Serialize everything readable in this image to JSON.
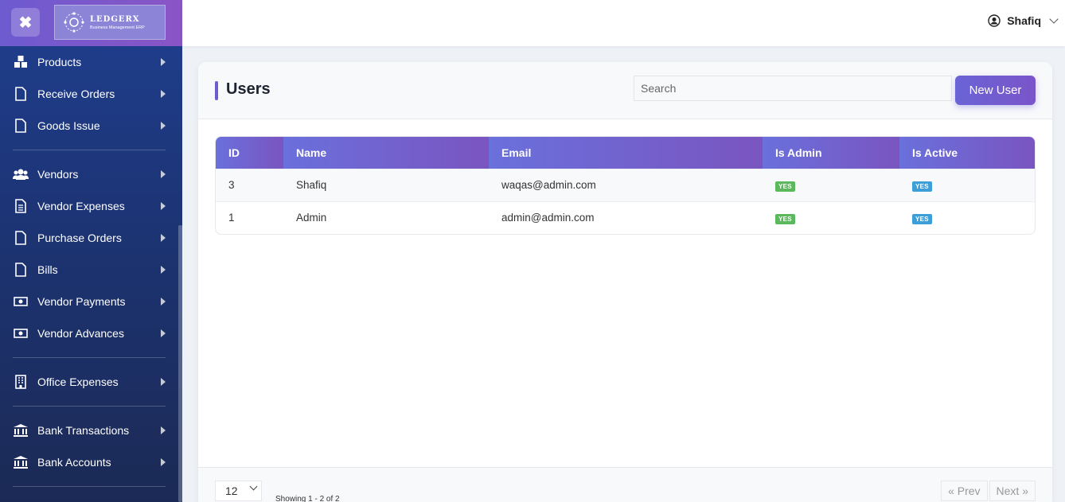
{
  "sidebar": {
    "logo": {
      "title": "LEDGERX",
      "subtitle": "Business Management ERP"
    },
    "items": [
      {
        "label": "Products",
        "icon": "boxes-icon"
      },
      {
        "label": "Receive Orders",
        "icon": "file-icon"
      },
      {
        "label": "Goods Issue",
        "icon": "file-icon"
      },
      {
        "label": "Vendors",
        "icon": "users-icon"
      },
      {
        "label": "Vendor Expenses",
        "icon": "file-text-icon"
      },
      {
        "label": "Purchase Orders",
        "icon": "file-icon"
      },
      {
        "label": "Bills",
        "icon": "file-icon"
      },
      {
        "label": "Vendor Payments",
        "icon": "money-icon"
      },
      {
        "label": "Vendor Advances",
        "icon": "money-icon"
      },
      {
        "label": "Office Expenses",
        "icon": "building-icon"
      },
      {
        "label": "Bank Transactions",
        "icon": "bank-icon"
      },
      {
        "label": "Bank Accounts",
        "icon": "bank-icon"
      }
    ]
  },
  "header": {
    "user_name": "Shafiq"
  },
  "page": {
    "title": "Users",
    "search_placeholder": "Search",
    "new_button": "New User"
  },
  "table": {
    "columns": [
      "ID",
      "Name",
      "Email",
      "Is Admin",
      "Is Active"
    ],
    "rows": [
      {
        "id": "3",
        "name": "Shafiq",
        "email": "waqas@admin.com",
        "is_admin": "YES",
        "is_active": "YES"
      },
      {
        "id": "1",
        "name": "Admin",
        "email": "admin@admin.com",
        "is_admin": "YES",
        "is_active": "YES"
      }
    ]
  },
  "footer": {
    "per_page": "12",
    "showing": "Showing 1 - 2 of 2",
    "prev": "« Prev",
    "next": "Next »"
  },
  "colors": {
    "accent": "#6d5bd0",
    "sidebar_top": "#1f3f8f",
    "sidebar_bottom": "#1b2a55",
    "badge_admin": "#5cb85c",
    "badge_active": "#3d9fd8"
  }
}
